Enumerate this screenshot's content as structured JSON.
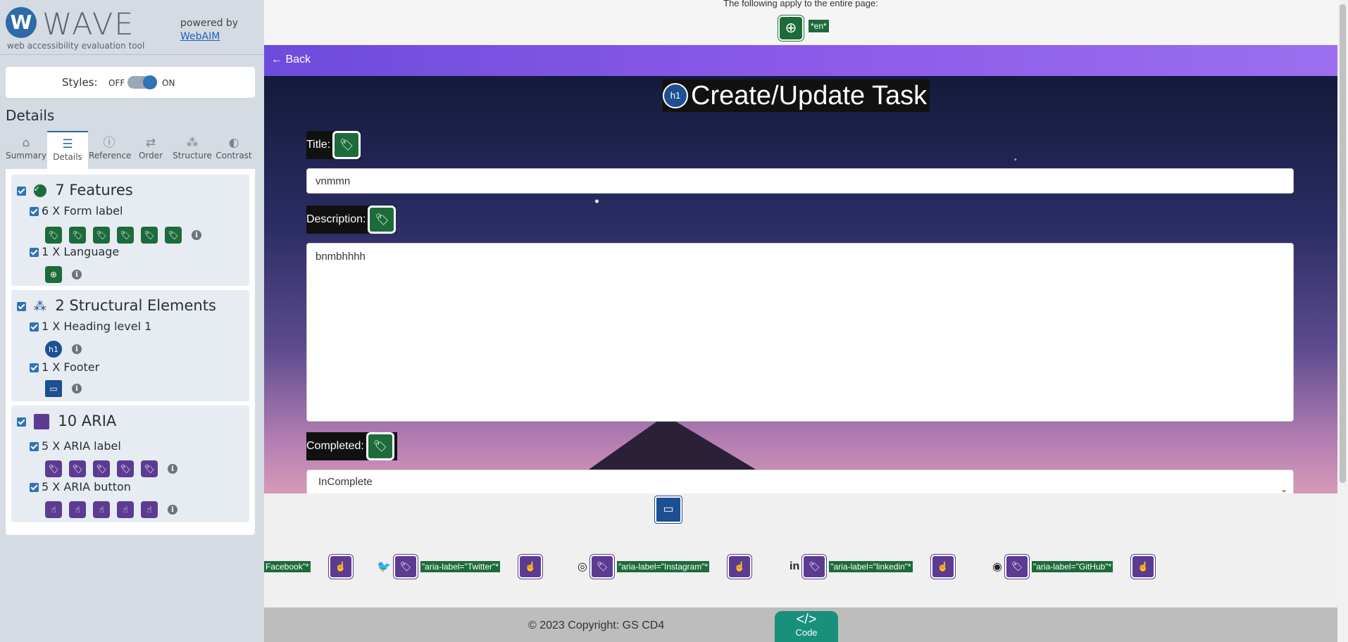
{
  "wave": {
    "logo": "W",
    "name": "WAVE",
    "subtitle": "web accessibility evaluation tool",
    "powered_by": "powered by",
    "webaim": "WebAIM",
    "styles_label": "Styles:",
    "styles_off": "OFF",
    "styles_on": "ON",
    "details_title": "Details",
    "tabs": [
      "Summary",
      "Details",
      "Reference",
      "Order",
      "Structure",
      "Contrast"
    ],
    "groups": {
      "features": {
        "title": "7 Features",
        "items": [
          "6 X Form label",
          "1 X Language"
        ]
      },
      "structural": {
        "title": "2 Structural Elements",
        "items": [
          "1 X Heading level 1",
          "1 X Footer"
        ]
      },
      "aria": {
        "title": "10 ARIA",
        "items": [
          "5 X ARIA label",
          "5 X ARIA button"
        ]
      }
    },
    "colors": {
      "feature": "#1d6b3a",
      "aria": "#5c3b93",
      "structure": "#1d4f91"
    }
  },
  "page": {
    "top_note": "The following apply to the entire page:",
    "lang_badge": "*en*",
    "back": "← Back",
    "h1_icon": "h1",
    "heading": "Create/Update Task",
    "title_label": "Title:",
    "title_value": "vnmmn",
    "description_label": "Description:",
    "description_value": "bnmbhhhh",
    "completed_label": "Completed:",
    "completed_value": "InComplete",
    "social": [
      {
        "glyph": "",
        "label": "Facebook\"*"
      },
      {
        "glyph": "🐦",
        "label": "\"aria-label=\"Twitter\"*"
      },
      {
        "glyph": "◎",
        "label": "\"aria-label=\"Instagram\"*"
      },
      {
        "glyph": "in",
        "label": "\"aria-label=\"linkedin\"*"
      },
      {
        "glyph": "◉",
        "label": "\"aria-label=\"GitHub\"*"
      }
    ],
    "copyright": "© 2023 Copyright: GS CD4",
    "code_button": "</>",
    "code_label": "Code"
  }
}
